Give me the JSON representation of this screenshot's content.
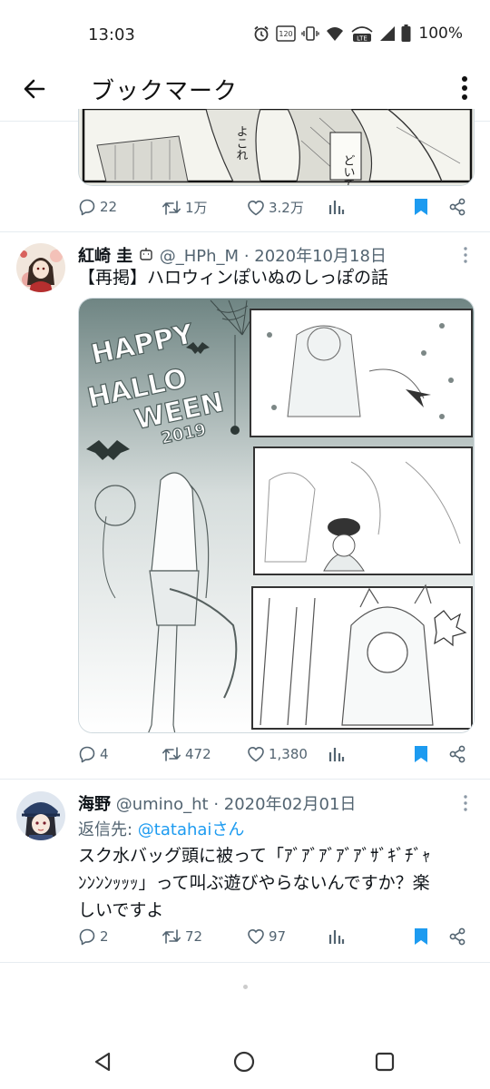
{
  "status_bar": {
    "time": "13:03",
    "battery": "100%",
    "hz_label": "120",
    "network_label": "LTE",
    "icons": [
      "alarm-icon",
      "refresh-rate-icon",
      "vibrate-icon",
      "wifi-icon",
      "volte-icon",
      "signal-icon",
      "battery-icon"
    ]
  },
  "header": {
    "title": "ブックマーク",
    "back_icon": "arrow-left-icon",
    "menu_icon": "more-vertical-icon"
  },
  "colors": {
    "accent": "#1d9bf0",
    "text": "#0f1419",
    "muted": "#536471",
    "divider": "#e6ecf0"
  },
  "tweets": [
    {
      "partial": true,
      "image_text_1": "よこれ",
      "image_text_2": "どいて",
      "replies": "22",
      "retweets": "1万",
      "likes": "3.2万"
    },
    {
      "name": "紅崎 圭",
      "handle": "@_HPh_M",
      "date": "2020年10月18日",
      "text": "【再掲】ハロウィンぽいぬのしっぽの話",
      "image_title_lines": [
        "HAPPY",
        "HALLO",
        "WEEN"
      ],
      "image_year": "2019",
      "replies": "4",
      "retweets": "472",
      "likes": "1,380"
    },
    {
      "name": "海野",
      "handle": "@umino_ht",
      "date": "2020年02月01日",
      "reply_prefix": "返信先: ",
      "reply_to": "@tatahaiさん",
      "text_lines": [
        "スク水バッグ頭に被って「ｱﾞｱﾞｱﾞｱﾞｱﾞｻﾞｷﾞﾁﾞｬ",
        "ﾝﾝﾝﾝｯｯｯ」って叫ぶ遊びやらないんですか？楽",
        "しいですよ"
      ],
      "replies": "2",
      "retweets": "72",
      "likes": "97"
    }
  ],
  "nav": {
    "icons": [
      "nav-back-icon",
      "nav-home-icon",
      "nav-recents-icon"
    ]
  }
}
